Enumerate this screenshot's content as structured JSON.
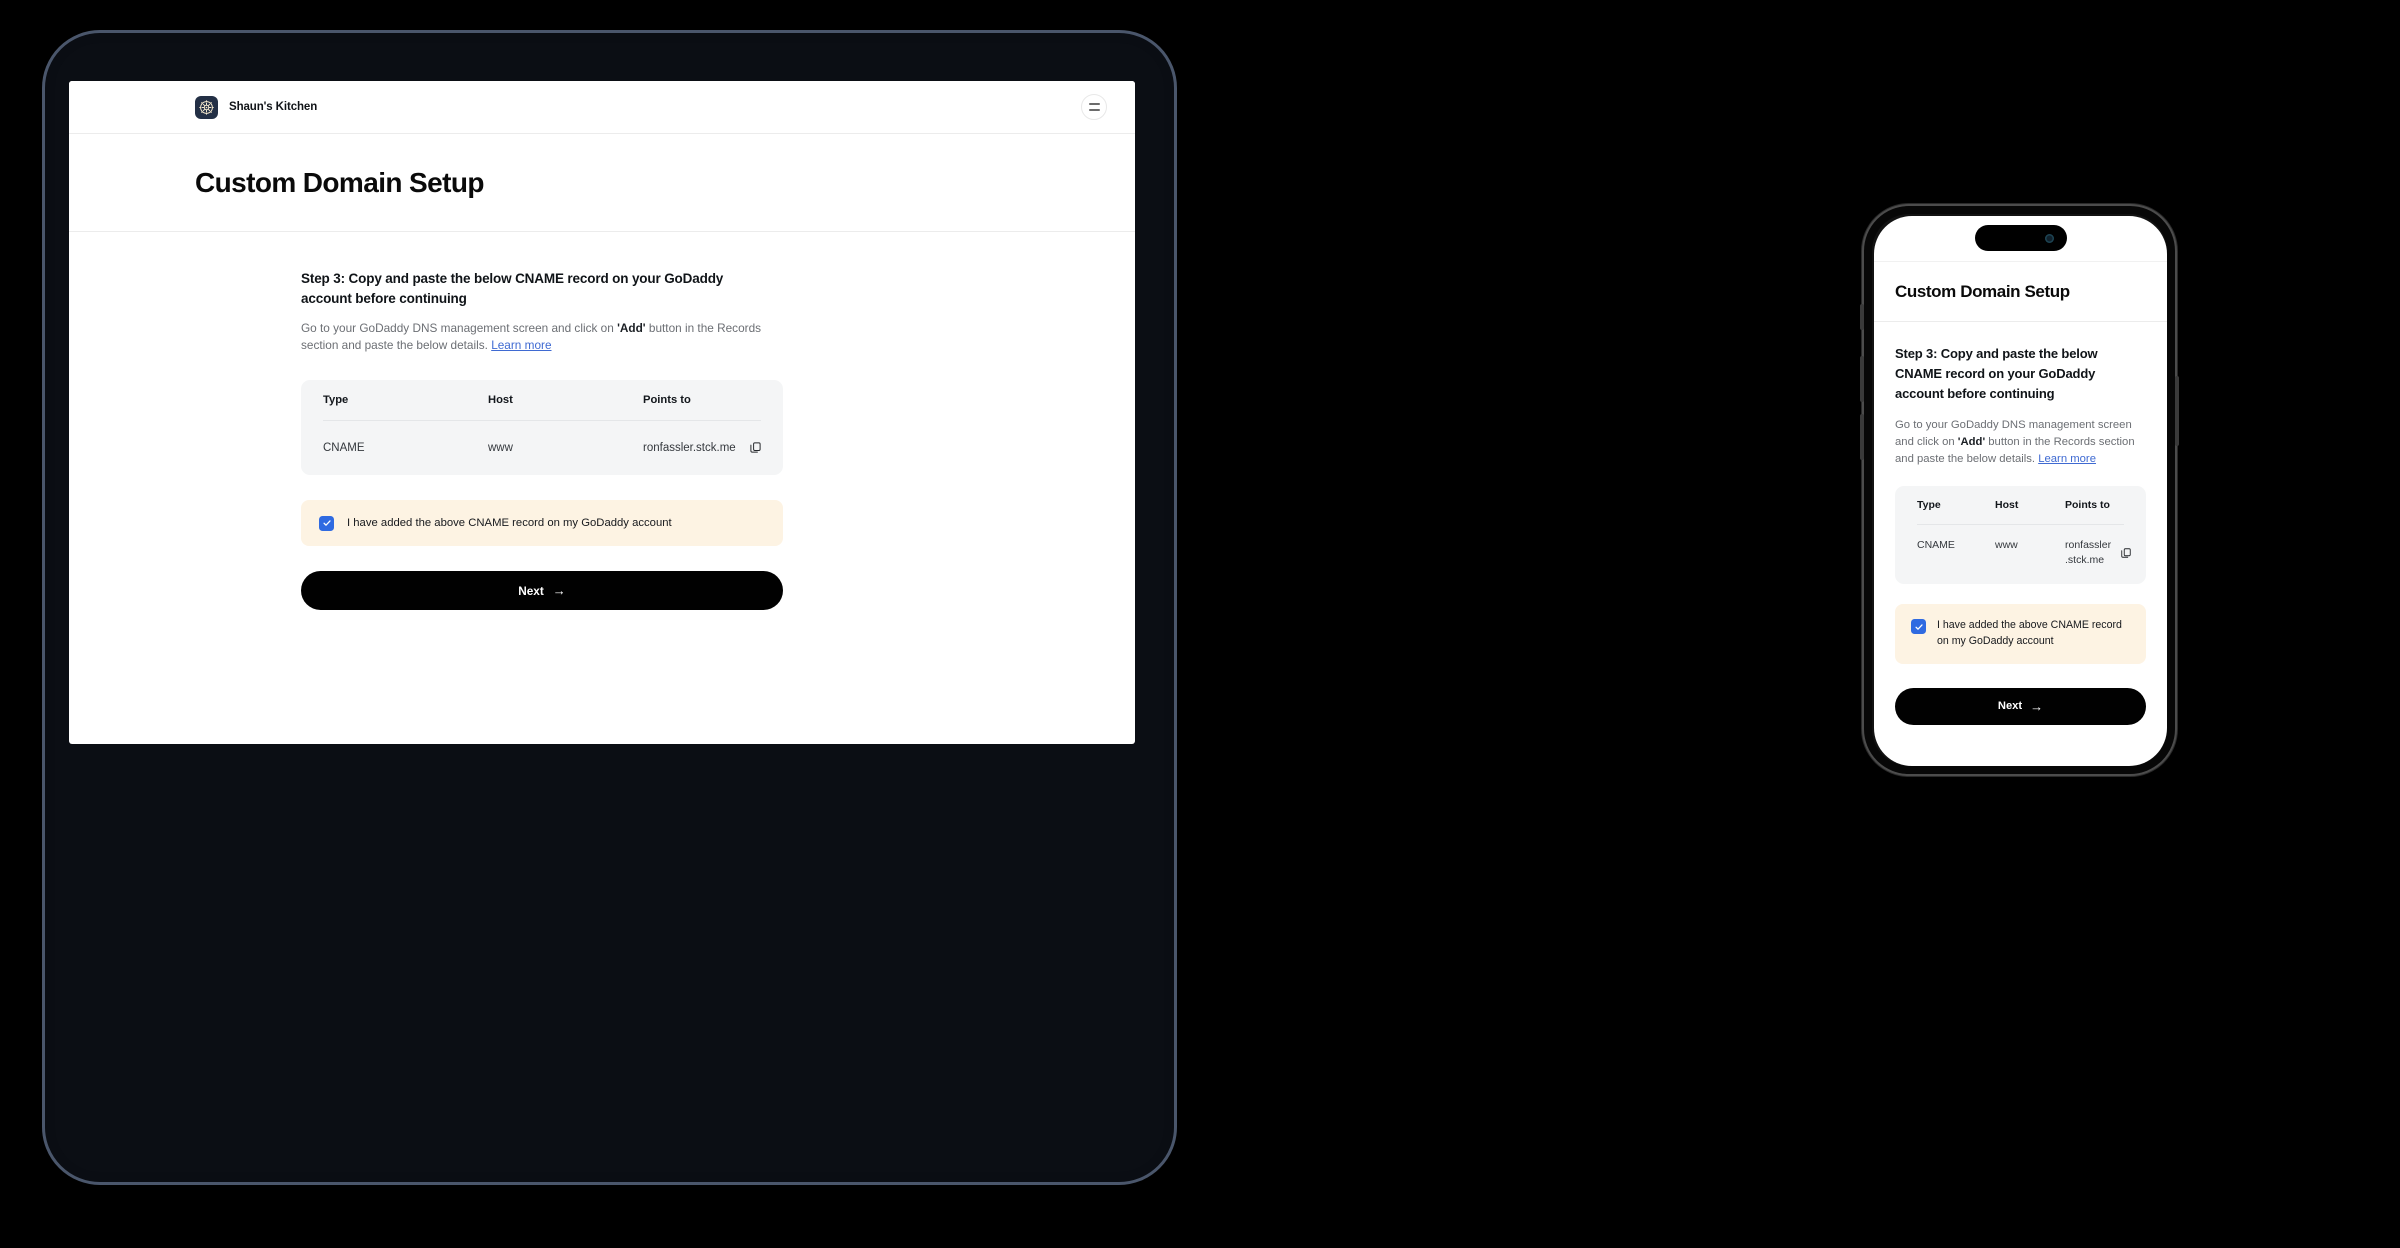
{
  "brand": {
    "name": "Shaun's Kitchen",
    "logo_icon": "ship-wheel-icon",
    "logo_bg": "#232f45",
    "logo_fg": "#f3e7cc"
  },
  "header": {
    "menu_icon": "hamburger-menu-icon"
  },
  "page": {
    "title": "Custom Domain Setup"
  },
  "step": {
    "heading": "Step 3: Copy and paste the below CNAME record on your GoDaddy account before continuing",
    "desc_part1": "Go to your GoDaddy DNS management screen and click on ",
    "desc_bold": "'Add'",
    "desc_part2": " button in the Records section and paste the below details. ",
    "learn_more": "Learn more",
    "link_color": "#3f6ad2"
  },
  "dns_table": {
    "columns": [
      "Type",
      "Host",
      "Points to"
    ],
    "rows": [
      {
        "type": "CNAME",
        "host": "www",
        "points_to": "ronfassler.stck.me",
        "copy_icon": "copy-icon"
      }
    ]
  },
  "confirm": {
    "label": "I have added the above CNAME record on my GoDaddy account",
    "checked": true,
    "checkbox_color": "#2f6ae1",
    "panel_bg": "#fdf3e3"
  },
  "next_button": {
    "label": "Next",
    "arrow": "→",
    "bg": "#010101",
    "fg": "#ffffff"
  },
  "devices": {
    "tablet_label": "tablet-preview",
    "phone_label": "phone-preview"
  }
}
